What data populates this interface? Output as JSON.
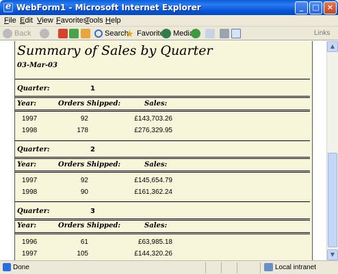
{
  "window": {
    "title": "WebForm1 - Microsoft Internet Explorer",
    "min_icon": "_",
    "max_icon": "□",
    "close_icon": "×"
  },
  "menu": [
    "File",
    "Edit",
    "View",
    "Favorites",
    "Tools",
    "Help"
  ],
  "toolbar": {
    "back": "Back",
    "search": "Search",
    "favorites": "Favorites",
    "media": "Media",
    "links": "Links"
  },
  "report": {
    "title": "Summary of Sales by Quarter",
    "date": "03-Mar-03",
    "quarter_label": "Quarter:",
    "headers": {
      "year": "Year:",
      "orders": "Orders Shipped:",
      "sales": "Sales:"
    },
    "quarters": [
      {
        "quarter": "1",
        "rows": [
          {
            "year": "1997",
            "orders": "92",
            "sales": "£143,703.26"
          },
          {
            "year": "1998",
            "orders": "178",
            "sales": "£276,329.95"
          }
        ]
      },
      {
        "quarter": "2",
        "rows": [
          {
            "year": "1997",
            "orders": "92",
            "sales": "£145,654.79"
          },
          {
            "year": "1998",
            "orders": "90",
            "sales": "£161,362.24"
          }
        ]
      },
      {
        "quarter": "3",
        "rows": [
          {
            "year": "1996",
            "orders": "61",
            "sales": "£63,985.18"
          },
          {
            "year": "1997",
            "orders": "105",
            "sales": "£144,320.26"
          }
        ]
      }
    ]
  },
  "status": {
    "text": "Done",
    "zone": "Local intranet"
  }
}
